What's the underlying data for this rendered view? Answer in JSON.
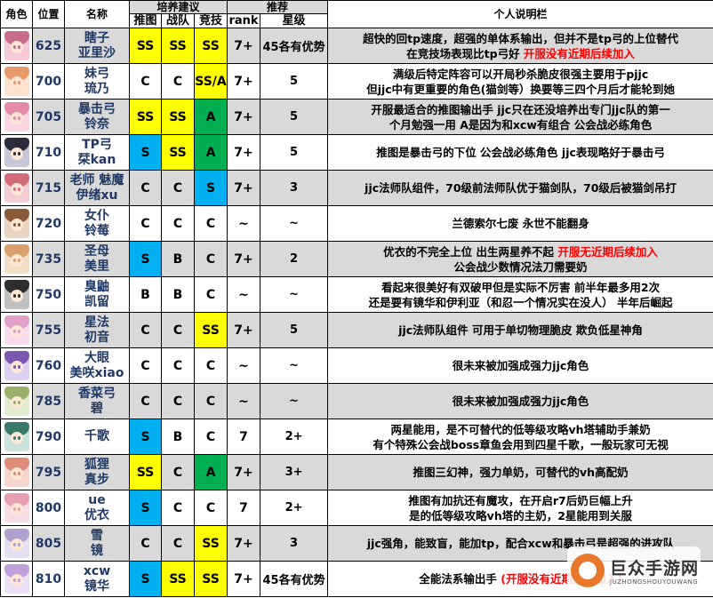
{
  "headers": {
    "role": "角色",
    "position": "位置",
    "name": "名称",
    "train_group": "培养建议",
    "push": "推图",
    "battle": "战队",
    "arena": "竞技",
    "recommend_group": "推荐",
    "rank": "rank",
    "star": "星级",
    "notes": "个人说明栏"
  },
  "colors": {
    "SS": "#ffff00",
    "S": "#00b0f0",
    "A": "#00b050",
    "SS/A": "#ffff00",
    "shade": "#d9d9d9"
  },
  "rows": [
    {
      "avatar_icon": "character-avatar-icon",
      "pos": "625",
      "name": [
        "瞎子",
        "亚里沙"
      ],
      "push": "SS",
      "battle": "SS",
      "arena": "SS",
      "rank": "7+",
      "star": "45各有优势",
      "shade": true,
      "lines": [
        [
          {
            "t": "超快的回tp速度，超强的单体系输出，但并不是tp弓的上位替代",
            "red": false
          }
        ],
        [
          {
            "t": "在竞技场表现比tp弓好  ",
            "red": false
          },
          {
            "t": "开服没有近期后续加入",
            "red": true
          }
        ]
      ]
    },
    {
      "avatar_icon": "character-avatar-icon",
      "pos": "700",
      "name": [
        "妹弓",
        "琉乃"
      ],
      "push": "C",
      "battle": "C",
      "arena": "SS/A",
      "rank": "7+",
      "star": "5",
      "shade": false,
      "lines": [
        [
          {
            "t": "满级后特定阵容可以开局秒杀脆皮很强主要用于pjjc",
            "red": false
          }
        ],
        [
          {
            "t": "但jjc中有更重要的角色(猫剑等）换要等三四个月后才能轮到她",
            "red": false
          }
        ]
      ]
    },
    {
      "avatar_icon": "character-avatar-icon",
      "pos": "705",
      "name": [
        "暴击弓",
        "铃奈"
      ],
      "push": "SS",
      "battle": "SS",
      "arena": "A",
      "rank": "7+",
      "star": "5",
      "shade": true,
      "lines": [
        [
          {
            "t": "开服最适合的推图输出手 jjc只在还没培养出专门jjc队的第一",
            "red": false
          }
        ],
        [
          {
            "t": "个月勉强一用  A是因为和xcw有组合      公会战必练角色",
            "red": false
          }
        ]
      ]
    },
    {
      "avatar_icon": "character-avatar-icon",
      "pos": "710",
      "name": [
        "TP弓",
        "栞kan"
      ],
      "push": "S",
      "battle": "SS",
      "arena": "A",
      "rank": "7+",
      "star": "5",
      "shade": false,
      "lines": [
        [
          {
            "t": "推图是暴击弓的下位  公会战必练角色   jjc表现略好于暴击弓",
            "red": false
          }
        ]
      ]
    },
    {
      "avatar_icon": "character-avatar-icon",
      "pos": "715",
      "name": [
        "老师 魅魔",
        "伊绪xu"
      ],
      "push": "C",
      "battle": "C",
      "arena": "S",
      "rank": "7+",
      "star": "3",
      "shade": true,
      "lines": [
        [
          {
            "t": "jjc法师队组件，70级前法师队优于猫剑队，70级后被猫剑吊打",
            "red": false
          }
        ]
      ]
    },
    {
      "avatar_icon": "character-avatar-icon",
      "pos": "720",
      "name": [
        "女仆",
        "铃莓"
      ],
      "push": "C",
      "battle": "C",
      "arena": "C",
      "rank": "~",
      "star": "~",
      "shade": false,
      "lines": [
        [
          {
            "t": "兰德索尔七废  永世不能翻身",
            "red": false
          }
        ]
      ]
    },
    {
      "avatar_icon": "character-avatar-icon",
      "pos": "735",
      "name": [
        "圣母",
        "美里"
      ],
      "push": "S",
      "battle": "B",
      "arena": "C",
      "rank": "7+",
      "star": "2",
      "shade": true,
      "lines": [
        [
          {
            "t": "优衣的不完全上位  出生两星养不起  ",
            "red": false
          },
          {
            "t": "开服无近期后续加入",
            "red": true
          }
        ],
        [
          {
            "t": "公会战少数情况法刀需要奶",
            "red": false
          }
        ]
      ]
    },
    {
      "avatar_icon": "character-avatar-icon",
      "pos": "750",
      "name": [
        "臭鼬",
        "凯留"
      ],
      "push": "B",
      "battle": "B",
      "arena": "C",
      "rank": "~",
      "star": "~",
      "shade": false,
      "lines": [
        [
          {
            "t": "看起来很美好有双破甲但是实际不厉害     前半年最多用2次",
            "red": false
          }
        ],
        [
          {
            "t": "还是要有镜华和伊利亚（和忍一个情况实在没人）  半年后崛起",
            "red": false
          }
        ]
      ]
    },
    {
      "avatar_icon": "character-avatar-icon",
      "pos": "755",
      "name": [
        "星法",
        "初音"
      ],
      "push": "C",
      "battle": "C",
      "arena": "SS",
      "rank": "7+",
      "star": "5",
      "shade": true,
      "lines": [
        [
          {
            "t": "jjc法师队组件   可用于单切物理脆皮  欺负低星神角",
            "red": false
          }
        ]
      ]
    },
    {
      "avatar_icon": "character-avatar-icon",
      "pos": "760",
      "name": [
        "大眼",
        "美咲xiao"
      ],
      "push": "C",
      "battle": "C",
      "arena": "C",
      "rank": "~",
      "star": "~",
      "shade": false,
      "lines": [
        [
          {
            "t": "很未来被加强成强力jjc角色",
            "red": false
          }
        ]
      ]
    },
    {
      "avatar_icon": "character-avatar-icon",
      "pos": "785",
      "name": [
        "香菜弓",
        "碧"
      ],
      "push": "C",
      "battle": "C",
      "arena": "C",
      "rank": "~",
      "star": "~",
      "shade": true,
      "lines": [
        [
          {
            "t": "很未来被加强成强力jjc角色",
            "red": false
          }
        ]
      ]
    },
    {
      "avatar_icon": "character-avatar-icon",
      "pos": "790",
      "name": [
        "千歌"
      ],
      "push": "S",
      "battle": "B",
      "arena": "C",
      "rank": "7",
      "star": "2+",
      "shade": false,
      "lines": [
        [
          {
            "t": "两星能用，是不可替代的低等级攻略vh塔辅助手兼奶",
            "red": false
          }
        ],
        [
          {
            "t": "有个特殊公会战boss章鱼会用到四星千歌，一般玩家可无视",
            "red": false
          }
        ]
      ]
    },
    {
      "avatar_icon": "character-avatar-icon",
      "pos": "795",
      "name": [
        "狐狸",
        "真步"
      ],
      "push": "SS",
      "battle": "C",
      "arena": "A",
      "rank": "7+",
      "star": "3+",
      "shade": true,
      "lines": [
        [
          {
            "t": "推图三幻神，强力单奶，可替代的vh高配奶",
            "red": false
          }
        ]
      ]
    },
    {
      "avatar_icon": "character-avatar-icon",
      "pos": "800",
      "name": [
        "ue",
        "优衣"
      ],
      "push": "S",
      "battle": "C",
      "arena": "C",
      "rank": "7",
      "star": "2+",
      "shade": false,
      "lines": [
        [
          {
            "t": "推图有加抗还有魔攻，在开启r7后奶巨幅上升",
            "red": false
          }
        ],
        [
          {
            "t": "是的低等级攻略vh塔的主奶，2星能用到关服",
            "red": false
          }
        ]
      ]
    },
    {
      "avatar_icon": "character-avatar-icon",
      "pos": "805",
      "name": [
        "雪",
        "镜"
      ],
      "push": "C",
      "battle": "C",
      "arena": "SS",
      "rank": "7+",
      "star": "3",
      "shade": true,
      "lines": [
        [
          {
            "t": "jjc强角，能致盲，能加tp，配合xcw和暴击弓是超强的进攻队",
            "red": false
          }
        ]
      ]
    },
    {
      "avatar_icon": "character-avatar-icon",
      "pos": "810",
      "name": [
        "xcw",
        "镜华"
      ],
      "push": "S",
      "battle": "SS",
      "arena": "SS",
      "rank": "7+",
      "star": "45各有优势",
      "shade": false,
      "lines": [
        [
          {
            "t": "全能法系输出手 ",
            "red": false
          },
          {
            "t": "(开服没有近期后续加入)",
            "red": true
          }
        ]
      ]
    }
  ],
  "watermark": {
    "logo_icon": "site-logo-icon",
    "title": "巨众手游网",
    "subtitle": "JUZHONGSHOUYOUWANG"
  }
}
